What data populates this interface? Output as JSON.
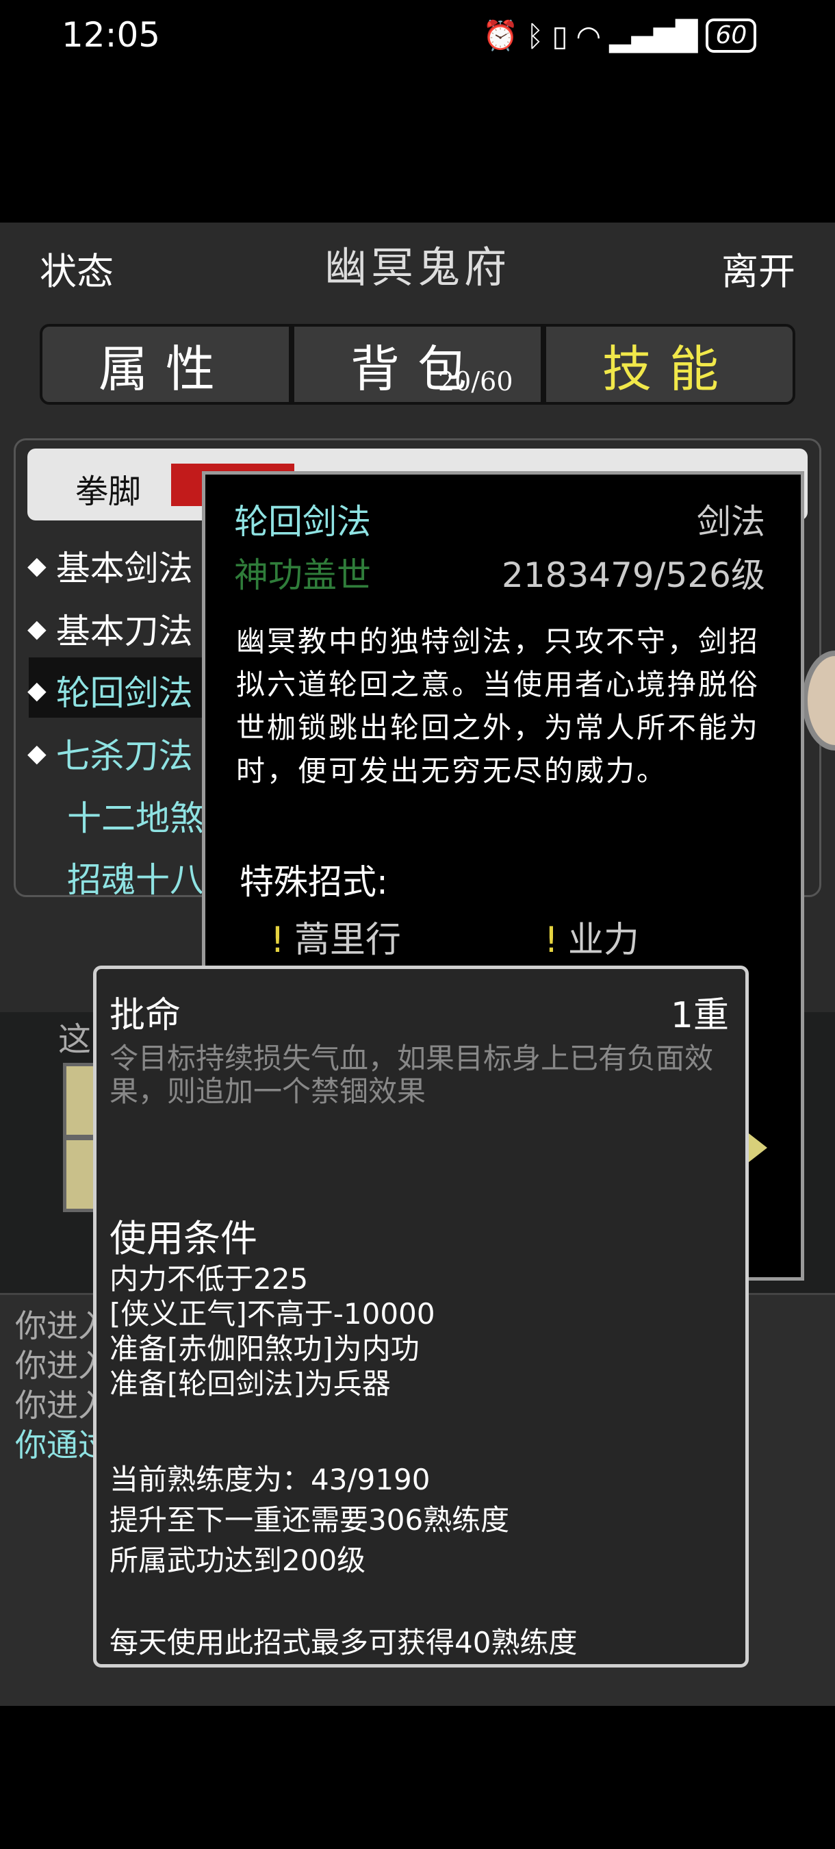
{
  "status_bar": {
    "time": "12:05",
    "battery": "60",
    "icons": [
      "alarm-icon",
      "bluetooth-icon",
      "vibrate-icon",
      "wifi-icon",
      "signal-4g-icon",
      "battery-icon"
    ]
  },
  "header": {
    "status_label": "状态",
    "title": "幽冥鬼府",
    "leave_label": "离开"
  },
  "tabs": [
    {
      "label": "属性",
      "active": false
    },
    {
      "label": "背包",
      "active": false,
      "count": "20/60"
    },
    {
      "label": "技能",
      "active": true
    }
  ],
  "skill_category_tab": "拳脚",
  "skills": [
    {
      "name": "基本剑法",
      "bullet": "◆",
      "style": "white"
    },
    {
      "name": "基本刀法",
      "bullet": "◆",
      "style": "white"
    },
    {
      "name": "轮回剑法",
      "bullet": "◆",
      "style": "teal",
      "selected": true
    },
    {
      "name": "七杀刀法",
      "bullet": "◆",
      "style": "teal"
    },
    {
      "name": "十二地煞",
      "bullet": "",
      "style": "teal"
    },
    {
      "name": "招魂十八",
      "bullet": "",
      "style": "teal"
    }
  ],
  "scene": {
    "text": "这"
  },
  "log": [
    {
      "text": "你进入",
      "style": "gray"
    },
    {
      "text": "你进入",
      "style": "gray"
    },
    {
      "text": "你进入",
      "style": "gray"
    },
    {
      "text": "你通过",
      "style": "teal"
    }
  ],
  "skill_detail": {
    "name": "轮回剑法",
    "type": "剑法",
    "rank": "神功盖世",
    "exp": "2183479/526级",
    "description": "幽冥教中的独特剑法，只攻不守，剑招拟六道轮回之意。当使用者心境挣脱俗世枷锁跳出轮回之外，为常人所不能为时，便可发出无穷无尽的威力。",
    "special_title": "特殊招式:",
    "specials": [
      "蒿里行",
      "业力"
    ]
  },
  "move_detail": {
    "name": "批命",
    "level": "1重",
    "description": "令目标持续损失气血，如果目标身上已有负面效果，则追加一个禁锢效果",
    "conditions_title": "使用条件",
    "conditions": [
      "内力不低于225",
      "[侠义正气]不高于-10000",
      "准备[赤伽阳煞功]为内功",
      "准备[轮回剑法]为兵器"
    ],
    "proficiency": "当前熟练度为：43/9190",
    "next_level": "提升至下一重还需要306熟练度",
    "required": "所属武功达到200级",
    "daily": "每天使用此招式最多可获得40熟练度"
  },
  "colors": {
    "active_tab": "#f1e84a",
    "teal_text": "#8fe3e3",
    "rank_green": "#2f7d3a",
    "exclaim": "#e5d340"
  }
}
